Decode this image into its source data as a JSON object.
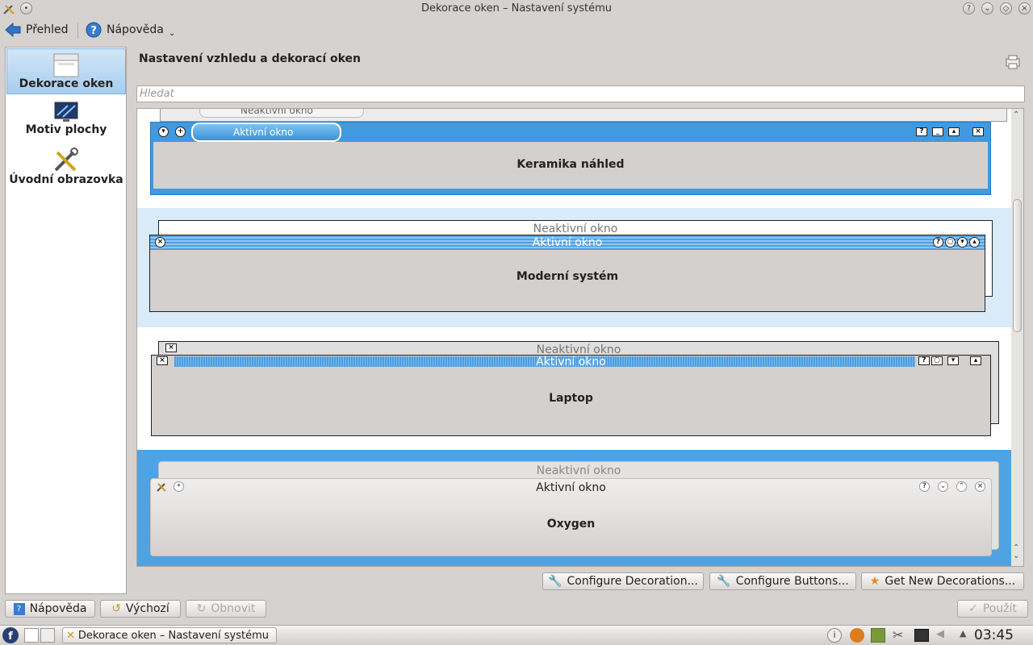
{
  "window": {
    "title": "Dekorace oken – Nastavení systému"
  },
  "toolbar": {
    "back_label": "Přehled",
    "help_label": "Nápověda"
  },
  "sidebar": {
    "items": [
      {
        "label": "Dekorace oken",
        "icon": "window-decoration-icon"
      },
      {
        "label": "Motiv plochy",
        "icon": "desktop-theme-icon"
      },
      {
        "label": "Úvodní obrazovka",
        "icon": "splash-tools-icon"
      }
    ]
  },
  "main": {
    "title": "Nastavení vzhledu a dekorací oken",
    "search_placeholder": "Hledat",
    "decorations": [
      {
        "name": "Keramika náhled",
        "inactive_title": "Neaktivní okno",
        "active_title": "Aktivní okno"
      },
      {
        "name": "Moderní systém",
        "inactive_title": "Neaktivní okno",
        "active_title": "Aktivní okno"
      },
      {
        "name": "Laptop",
        "inactive_title": "Neaktivní okno",
        "active_title": "Aktivní okno"
      },
      {
        "name": "Oxygen",
        "inactive_title": "Neaktivní okno",
        "active_title": "Aktivní okno",
        "selected": true
      }
    ]
  },
  "actions": {
    "configure_decoration": "Configure Decoration...",
    "configure_buttons": "Configure Buttons...",
    "get_new": "Get New Decorations..."
  },
  "footer": {
    "help": "Nápověda",
    "defaults": "Výchozí",
    "reset": "Obnovit",
    "apply": "Použít"
  },
  "taskbar": {
    "task_label": "Dekorace oken – Nastavení systému",
    "clock": "03:45"
  },
  "colors": {
    "accent": "#5aa9e6",
    "selected_row": "#4da3e3",
    "keramika_blue": "#3f9ae0"
  }
}
